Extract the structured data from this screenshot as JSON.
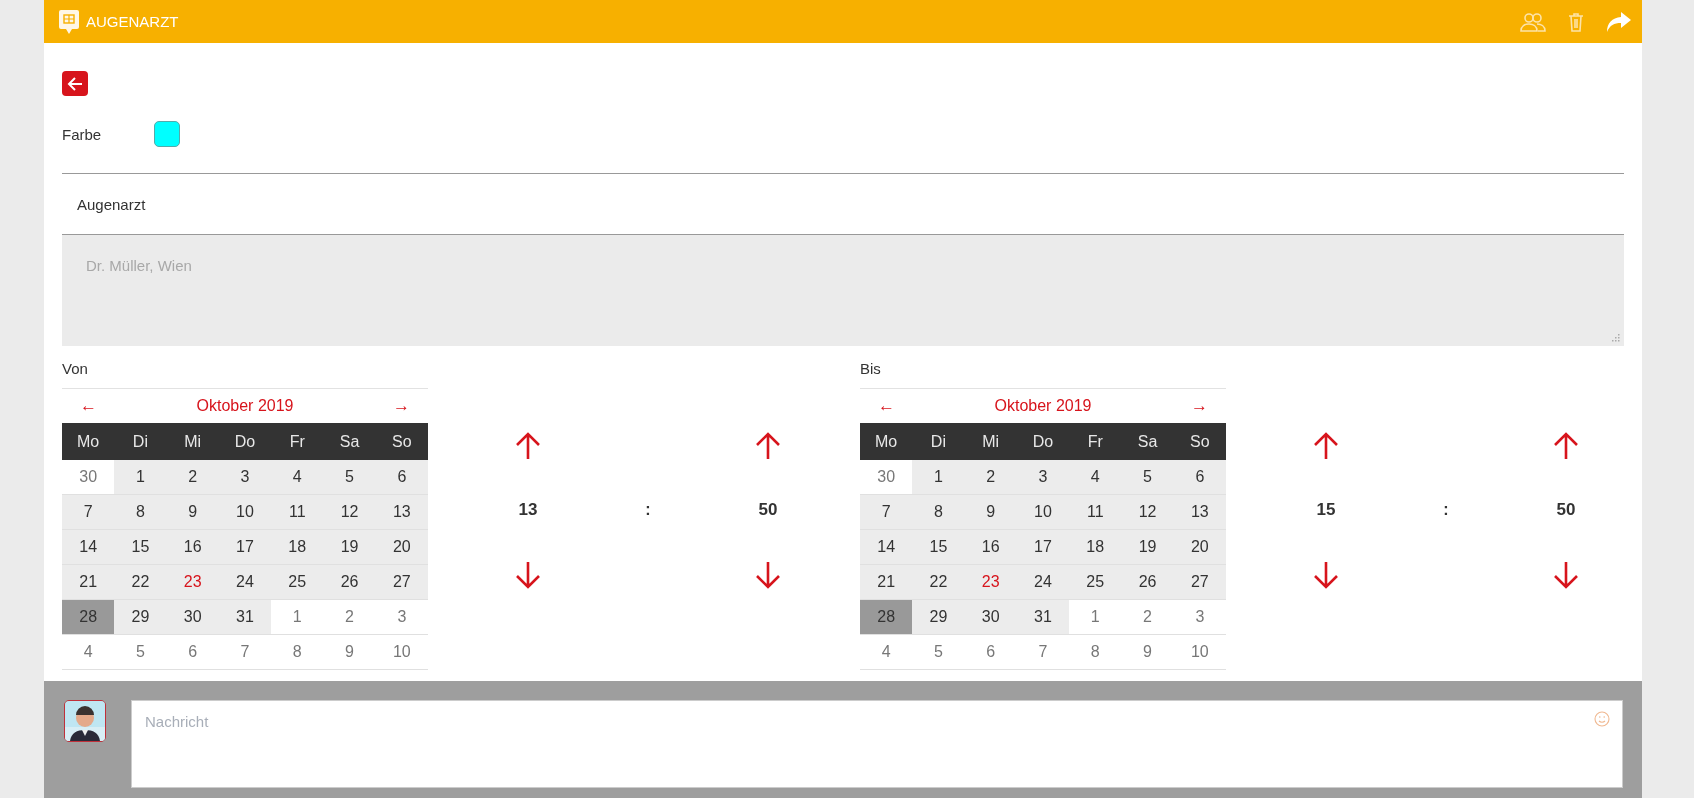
{
  "header": {
    "title": "AUGENARZT"
  },
  "color_field": {
    "label": "Farbe",
    "color": "#00ffff"
  },
  "title_field": {
    "value": "Augenarzt"
  },
  "notes_field": {
    "placeholder": "Dr. Müller, Wien"
  },
  "ranges": [
    {
      "label": "Von",
      "calendar": {
        "prev": "←",
        "month": "Oktober 2019",
        "next": "→",
        "weekdays": [
          "Mo",
          "Di",
          "Mi",
          "Do",
          "Fr",
          "Sa",
          "So"
        ],
        "weeks": [
          [
            {
              "day": "30",
              "outside": true,
              "today": false,
              "selected": false
            },
            {
              "day": "1",
              "outside": false,
              "today": false,
              "selected": false
            },
            {
              "day": "2",
              "outside": false,
              "today": false,
              "selected": false
            },
            {
              "day": "3",
              "outside": false,
              "today": false,
              "selected": false
            },
            {
              "day": "4",
              "outside": false,
              "today": false,
              "selected": false
            },
            {
              "day": "5",
              "outside": false,
              "today": false,
              "selected": false
            },
            {
              "day": "6",
              "outside": false,
              "today": false,
              "selected": false
            }
          ],
          [
            {
              "day": "7",
              "outside": false,
              "today": false,
              "selected": false
            },
            {
              "day": "8",
              "outside": false,
              "today": false,
              "selected": false
            },
            {
              "day": "9",
              "outside": false,
              "today": false,
              "selected": false
            },
            {
              "day": "10",
              "outside": false,
              "today": false,
              "selected": false
            },
            {
              "day": "11",
              "outside": false,
              "today": false,
              "selected": false
            },
            {
              "day": "12",
              "outside": false,
              "today": false,
              "selected": false
            },
            {
              "day": "13",
              "outside": false,
              "today": false,
              "selected": false
            }
          ],
          [
            {
              "day": "14",
              "outside": false,
              "today": false,
              "selected": false
            },
            {
              "day": "15",
              "outside": false,
              "today": false,
              "selected": false
            },
            {
              "day": "16",
              "outside": false,
              "today": false,
              "selected": false
            },
            {
              "day": "17",
              "outside": false,
              "today": false,
              "selected": false
            },
            {
              "day": "18",
              "outside": false,
              "today": false,
              "selected": false
            },
            {
              "day": "19",
              "outside": false,
              "today": false,
              "selected": false
            },
            {
              "day": "20",
              "outside": false,
              "today": false,
              "selected": false
            }
          ],
          [
            {
              "day": "21",
              "outside": false,
              "today": false,
              "selected": false
            },
            {
              "day": "22",
              "outside": false,
              "today": false,
              "selected": false
            },
            {
              "day": "23",
              "outside": false,
              "today": true,
              "selected": false
            },
            {
              "day": "24",
              "outside": false,
              "today": false,
              "selected": false
            },
            {
              "day": "25",
              "outside": false,
              "today": false,
              "selected": false
            },
            {
              "day": "26",
              "outside": false,
              "today": false,
              "selected": false
            },
            {
              "day": "27",
              "outside": false,
              "today": false,
              "selected": false
            }
          ],
          [
            {
              "day": "28",
              "outside": false,
              "today": false,
              "selected": true
            },
            {
              "day": "29",
              "outside": false,
              "today": false,
              "selected": false
            },
            {
              "day": "30",
              "outside": false,
              "today": false,
              "selected": false
            },
            {
              "day": "31",
              "outside": false,
              "today": false,
              "selected": false
            },
            {
              "day": "1",
              "outside": true,
              "today": false,
              "selected": false
            },
            {
              "day": "2",
              "outside": true,
              "today": false,
              "selected": false
            },
            {
              "day": "3",
              "outside": true,
              "today": false,
              "selected": false
            }
          ],
          [
            {
              "day": "4",
              "outside": true,
              "today": false,
              "selected": false
            },
            {
              "day": "5",
              "outside": true,
              "today": false,
              "selected": false
            },
            {
              "day": "6",
              "outside": true,
              "today": false,
              "selected": false
            },
            {
              "day": "7",
              "outside": true,
              "today": false,
              "selected": false
            },
            {
              "day": "8",
              "outside": true,
              "today": false,
              "selected": false
            },
            {
              "day": "9",
              "outside": true,
              "today": false,
              "selected": false
            },
            {
              "day": "10",
              "outside": true,
              "today": false,
              "selected": false
            }
          ]
        ]
      },
      "time": {
        "hours": "13",
        "separator": ":",
        "minutes": "50"
      }
    },
    {
      "label": "Bis",
      "calendar": {
        "prev": "←",
        "month": "Oktober 2019",
        "next": "→",
        "weekdays": [
          "Mo",
          "Di",
          "Mi",
          "Do",
          "Fr",
          "Sa",
          "So"
        ],
        "weeks": [
          [
            {
              "day": "30",
              "outside": true,
              "today": false,
              "selected": false
            },
            {
              "day": "1",
              "outside": false,
              "today": false,
              "selected": false
            },
            {
              "day": "2",
              "outside": false,
              "today": false,
              "selected": false
            },
            {
              "day": "3",
              "outside": false,
              "today": false,
              "selected": false
            },
            {
              "day": "4",
              "outside": false,
              "today": false,
              "selected": false
            },
            {
              "day": "5",
              "outside": false,
              "today": false,
              "selected": false
            },
            {
              "day": "6",
              "outside": false,
              "today": false,
              "selected": false
            }
          ],
          [
            {
              "day": "7",
              "outside": false,
              "today": false,
              "selected": false
            },
            {
              "day": "8",
              "outside": false,
              "today": false,
              "selected": false
            },
            {
              "day": "9",
              "outside": false,
              "today": false,
              "selected": false
            },
            {
              "day": "10",
              "outside": false,
              "today": false,
              "selected": false
            },
            {
              "day": "11",
              "outside": false,
              "today": false,
              "selected": false
            },
            {
              "day": "12",
              "outside": false,
              "today": false,
              "selected": false
            },
            {
              "day": "13",
              "outside": false,
              "today": false,
              "selected": false
            }
          ],
          [
            {
              "day": "14",
              "outside": false,
              "today": false,
              "selected": false
            },
            {
              "day": "15",
              "outside": false,
              "today": false,
              "selected": false
            },
            {
              "day": "16",
              "outside": false,
              "today": false,
              "selected": false
            },
            {
              "day": "17",
              "outside": false,
              "today": false,
              "selected": false
            },
            {
              "day": "18",
              "outside": false,
              "today": false,
              "selected": false
            },
            {
              "day": "19",
              "outside": false,
              "today": false,
              "selected": false
            },
            {
              "day": "20",
              "outside": false,
              "today": false,
              "selected": false
            }
          ],
          [
            {
              "day": "21",
              "outside": false,
              "today": false,
              "selected": false
            },
            {
              "day": "22",
              "outside": false,
              "today": false,
              "selected": false
            },
            {
              "day": "23",
              "outside": false,
              "today": true,
              "selected": false
            },
            {
              "day": "24",
              "outside": false,
              "today": false,
              "selected": false
            },
            {
              "day": "25",
              "outside": false,
              "today": false,
              "selected": false
            },
            {
              "day": "26",
              "outside": false,
              "today": false,
              "selected": false
            },
            {
              "day": "27",
              "outside": false,
              "today": false,
              "selected": false
            }
          ],
          [
            {
              "day": "28",
              "outside": false,
              "today": false,
              "selected": true
            },
            {
              "day": "29",
              "outside": false,
              "today": false,
              "selected": false
            },
            {
              "day": "30",
              "outside": false,
              "today": false,
              "selected": false
            },
            {
              "day": "31",
              "outside": false,
              "today": false,
              "selected": false
            },
            {
              "day": "1",
              "outside": true,
              "today": false,
              "selected": false
            },
            {
              "day": "2",
              "outside": true,
              "today": false,
              "selected": false
            },
            {
              "day": "3",
              "outside": true,
              "today": false,
              "selected": false
            }
          ],
          [
            {
              "day": "4",
              "outside": true,
              "today": false,
              "selected": false
            },
            {
              "day": "5",
              "outside": true,
              "today": false,
              "selected": false
            },
            {
              "day": "6",
              "outside": true,
              "today": false,
              "selected": false
            },
            {
              "day": "7",
              "outside": true,
              "today": false,
              "selected": false
            },
            {
              "day": "8",
              "outside": true,
              "today": false,
              "selected": false
            },
            {
              "day": "9",
              "outside": true,
              "today": false,
              "selected": false
            },
            {
              "day": "10",
              "outside": true,
              "today": false,
              "selected": false
            }
          ]
        ]
      },
      "time": {
        "hours": "15",
        "separator": ":",
        "minutes": "50"
      }
    }
  ],
  "composer": {
    "placeholder": "Nachricht"
  }
}
